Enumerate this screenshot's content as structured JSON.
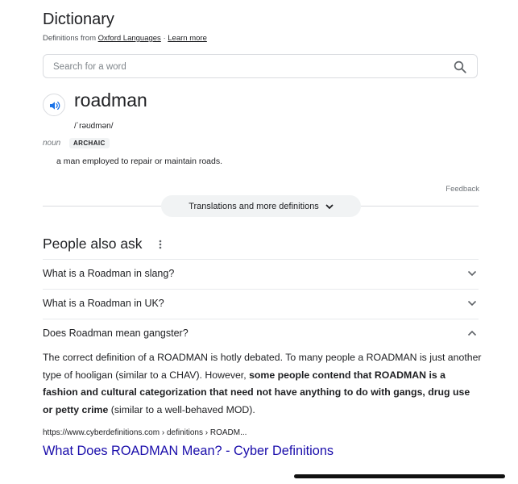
{
  "dictionary": {
    "title": "Dictionary",
    "subtitle_prefix": "Definitions from ",
    "source_link": "Oxford Languages",
    "separator": " · ",
    "learn_more": "Learn more",
    "search_placeholder": "Search for a word",
    "word": "roadman",
    "phonetic": "/ˈrəʊdmən/",
    "part_of_speech": "noun",
    "badge": "ARCHAIC",
    "definition": "a man employed to repair or maintain roads.",
    "feedback": "Feedback",
    "translations_button": "Translations and more definitions"
  },
  "people_also_ask": {
    "title": "People also ask",
    "questions": [
      {
        "text": "What is a Roadman in slang?",
        "expanded": false
      },
      {
        "text": "What is a Roadman in UK?",
        "expanded": false
      },
      {
        "text": "Does Roadman mean gangster?",
        "expanded": true
      }
    ],
    "answer": {
      "part1": "The correct definition of a ROADMAN is hotly debated. To many people a ROADMAN is just another type of hooligan (similar to a CHAV). However, ",
      "bold": "some people contend that ROADMAN is a fashion and cultural categorization that need not have anything to do with gangs, drug use or petty crime",
      "part2": " (similar to a well-behaved MOD)."
    },
    "source_url": "https://www.cyberdefinitions.com › definitions › ROADM...",
    "source_title": "What Does ROADMAN Mean? - Cyber Definitions"
  },
  "colors": {
    "link_blue": "#1a0dab",
    "speaker_blue": "#1a73e8",
    "text": "#202124",
    "muted": "#70757a"
  }
}
